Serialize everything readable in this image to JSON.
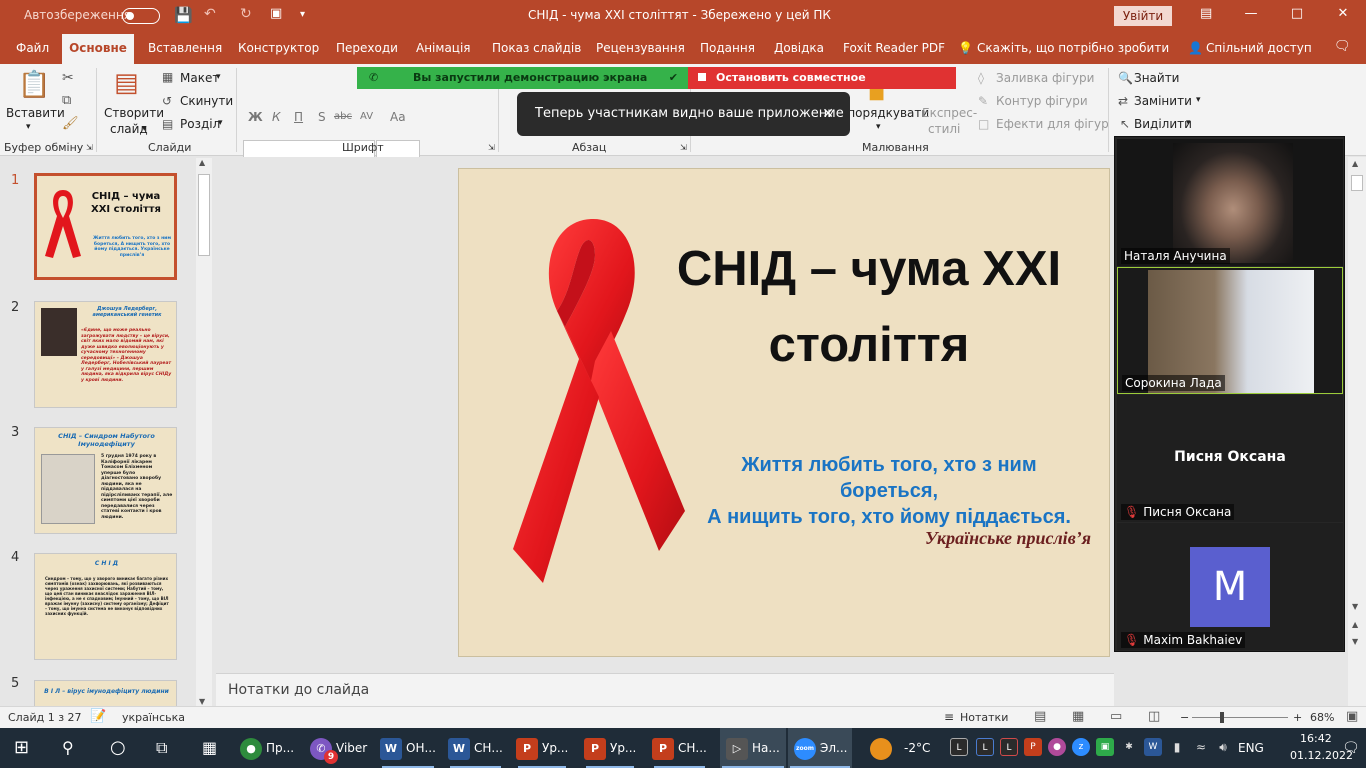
{
  "title_bar": {
    "autosave_label": "Автозбереження",
    "autosave_state": "off",
    "document_title": "СНІД - чума ХХІ століттят  -  Збережено у цей ПК",
    "login_button": "Увійти",
    "minimize": "—",
    "maximize": "□",
    "close": "✕"
  },
  "ribbon_tabs": {
    "file": "Файл",
    "home": "Основне",
    "insert": "Вставлення",
    "design": "Конструктор",
    "transitions": "Переходи",
    "animation": "Анімація",
    "slideshow": "Показ слайдів",
    "review": "Рецензування",
    "view": "Подання",
    "help": "Довідка",
    "foxit": "Foxit Reader PDF",
    "tell_me": "Скажіть, що потрібно зробити",
    "share": "Спільний доступ"
  },
  "ribbon": {
    "paste": "Вставити",
    "clipboard_group": "Буфер обміну",
    "new_slide_line1": "Створити",
    "new_slide_line2": "слайд",
    "layout": "Макет",
    "reset": "Скинути",
    "section": "Розділ",
    "slides_group": "Слайди",
    "font_group": "Шрифт",
    "paragraph_group": "Абзац",
    "arrange": "Упорядкувати",
    "quick_styles_line1": "Експрес-",
    "quick_styles_line2": "стилі",
    "shape_fill": "Заливка фігури",
    "shape_outline": "Контур фігури",
    "shape_effects": "Ефекти для фігур",
    "drawing_group": "Малювання",
    "find": "Знайти",
    "replace": "Замінити",
    "select": "Виділити",
    "bold": "Ж",
    "italic": "К",
    "underline": "П",
    "shadow": "S",
    "strike": "abc",
    "spacing": "AV",
    "case": "Aa"
  },
  "screen_share": {
    "status_text": "Вы запустили демонстрацию экрана",
    "stop_button": "Остановить совместное использование",
    "toast_text": "Теперь участникам видно ваше приложение",
    "toast_close": "✕"
  },
  "slides_panel": {
    "slides": [
      {
        "number": "1",
        "title": "СНІД – чума ХХІ століття",
        "body": "Життя любить того, хто з ним бореться, А нищить того, хто йому піддається. Українське прислів’я"
      },
      {
        "number": "2",
        "title": "Джошуа Ледерберг, американський генетик",
        "body": "«Єдине, що може реально загрожувати людству – це віруси, світ яких мало відомий нам, які дуже швидко еволюціонують у сучасному техногенному середовищі» – Джошуа Ледерберг, Нобелівський лауреат у галузі медицини, першим людина, яка відкрила вірус СНІДу у крові людини."
      },
      {
        "number": "3",
        "title": "СНІД – Синдром Набутого Імунодефіциту",
        "body": "5 грудня 1974 року в Каліфорнії лікарем Томасом Еліхменом уперше було діагностовано хворобу людини, яка не піддавалася на підірсліливанх терапії, але симптоми цієї хвороби передавалися через статеві контакти і кров людини."
      },
      {
        "number": "4",
        "title": "С Н І Д",
        "body": "Синдром – тому, що у хворого виникає багато різних симптомів (ознак) захворювань, які розвиваються через ураження захисної системи; Набутий – тому, що цей стан виникає внаслідок зараження ВІЛ-інфекцією, а не є спадковим; Імунний – тому, що ВІЛ вражає імунну (захисну) систему організму; Дефіцит – тому, що імунна система не виконує відповідних захисних функцій."
      },
      {
        "number": "5",
        "title": "В І Л – вірус імунодефіциту людини",
        "body": ""
      }
    ]
  },
  "slide": {
    "title": "СНІД – чума ХХІ століття",
    "quote_line1": "Життя любить того, хто з ним",
    "quote_line2": "бореться,",
    "quote_line3": "А нищить того, хто йому піддається.",
    "source": "Українське прислів’я",
    "ribbon_color": "#e2161c"
  },
  "notes": {
    "placeholder": "Нотатки до слайда"
  },
  "zoom": {
    "participants": [
      {
        "name": "Наталя Анучина",
        "video": true,
        "muted": false
      },
      {
        "name": "Сорокина Лада",
        "video": true,
        "muted": false,
        "speaking": true
      },
      {
        "name": "Писня Оксана",
        "display_name": "Писня Оксана",
        "video": false,
        "muted": true
      },
      {
        "name": "Maxim Bakhaiev",
        "initial": "M",
        "video": false,
        "muted": true,
        "avatar_color": "#5a5fcf"
      }
    ]
  },
  "status_bar": {
    "slide_counter": "Слайд 1 з 27",
    "language": "українська",
    "notes_button": "Нотатки",
    "zoom_level": "68%",
    "zoom_minus": "−",
    "zoom_plus": "+"
  },
  "taskbar": {
    "apps": [
      {
        "label": "Пр...",
        "icon": "chrome-icon",
        "color": "#2e8b3d"
      },
      {
        "label": "Viber",
        "icon": "viber-icon",
        "color": "#7d57c2",
        "badge": "9"
      },
      {
        "label": "ОН...",
        "icon": "word-icon",
        "color": "#2b5797"
      },
      {
        "label": "СН...",
        "icon": "word-icon",
        "color": "#2b5797"
      },
      {
        "label": "Ур...",
        "icon": "powerpoint-icon",
        "color": "#c43e1c"
      },
      {
        "label": "Ур...",
        "icon": "powerpoint-icon",
        "color": "#c43e1c"
      },
      {
        "label": "СН...",
        "icon": "powerpoint-icon",
        "color": "#c43e1c"
      },
      {
        "label": "На...",
        "icon": "clapper-icon",
        "color": "#555"
      },
      {
        "label": "Эл...",
        "icon": "zoom-icon",
        "color": "#2d8cff"
      }
    ],
    "weather": "-2°C",
    "language": "ENG",
    "time": "16:42",
    "date": "01.12.2022"
  }
}
